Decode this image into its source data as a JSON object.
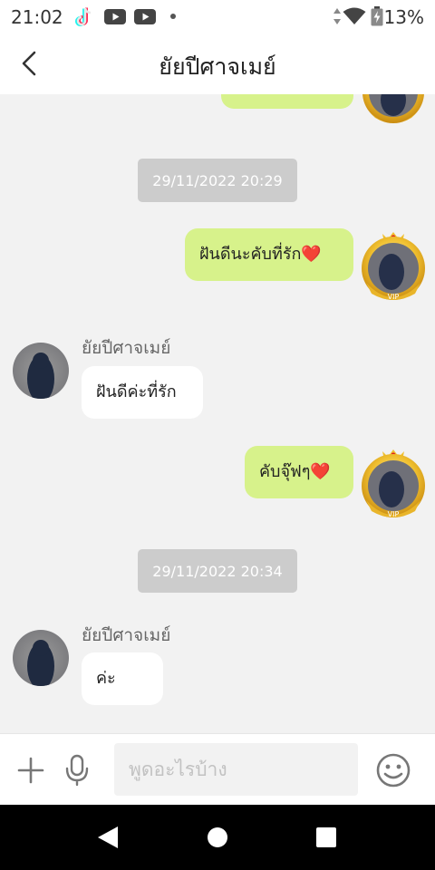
{
  "status_bar": {
    "time": "21:02",
    "battery_percent": "13%",
    "icons": [
      "tiktok-icon",
      "youtube-icon",
      "youtube-icon",
      "dot-icon",
      "data-arrows-icon",
      "wifi-icon",
      "battery-charging-icon"
    ]
  },
  "header": {
    "title": "ยัยปีศาจเมย์",
    "back_icon": "chevron-left-icon"
  },
  "messages": [
    {
      "type": "outgoing",
      "text": "",
      "partial": true
    },
    {
      "type": "timestamp",
      "text": "29/11/2022 20:29"
    },
    {
      "type": "outgoing",
      "text": "ฝันดีนะคับที่รัก❤️"
    },
    {
      "type": "incoming",
      "sender": "ยัยปีศาจเมย์",
      "text": "ฝันดีค่ะที่รัก"
    },
    {
      "type": "outgoing",
      "text": "คับจุ๊ฟๆ❤️"
    },
    {
      "type": "timestamp",
      "text": "29/11/2022 20:34"
    },
    {
      "type": "incoming",
      "sender": "ยัยปีศาจเมย์",
      "text": "ค่ะ"
    }
  ],
  "input_bar": {
    "placeholder": "พูดอะไรบ้าง",
    "value": "",
    "icons": [
      "plus-icon",
      "microphone-icon",
      "emoji-icon"
    ]
  },
  "nav_bar": {
    "icons": [
      "back-triangle-icon",
      "home-circle-icon",
      "recents-square-icon"
    ]
  },
  "colors": {
    "outgoing_bubble": "#d7f28b",
    "incoming_bubble": "#ffffff",
    "timestamp_bg": "#cccccc",
    "chat_bg": "#f2f2f2",
    "heart": "#e02020"
  }
}
